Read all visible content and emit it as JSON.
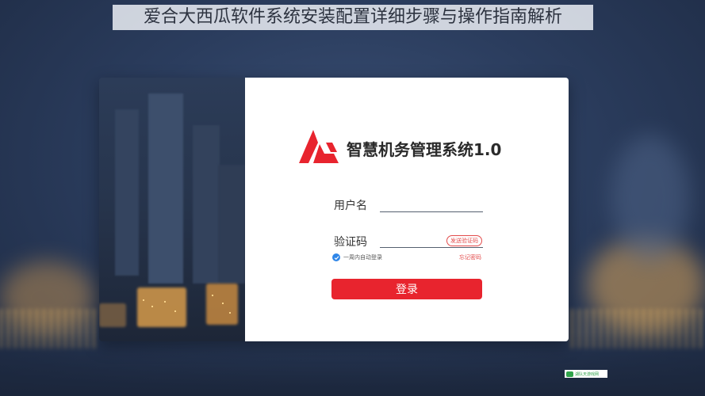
{
  "page": {
    "title_banner": "爱合大西瓜软件系统安装配置详细步骤与操作指南解析"
  },
  "login": {
    "app_title": "智慧机务管理系统1.0",
    "username_label": "用户名",
    "username_value": "",
    "captcha_label": "验证码",
    "captcha_value": "",
    "send_code_label": "发送验证码",
    "remember_label": "一周内自动登录",
    "remember_checked": true,
    "forgot_label": "忘记密码",
    "submit_label": "登录"
  },
  "icons": {
    "logo": "brand-logo-icon",
    "remember_check": "check-icon"
  },
  "colors": {
    "accent": "#e8242e",
    "checkbox": "#2f86e8",
    "background": "#2b3d5e"
  },
  "watermark": {
    "text": "湖队天游戏网"
  }
}
